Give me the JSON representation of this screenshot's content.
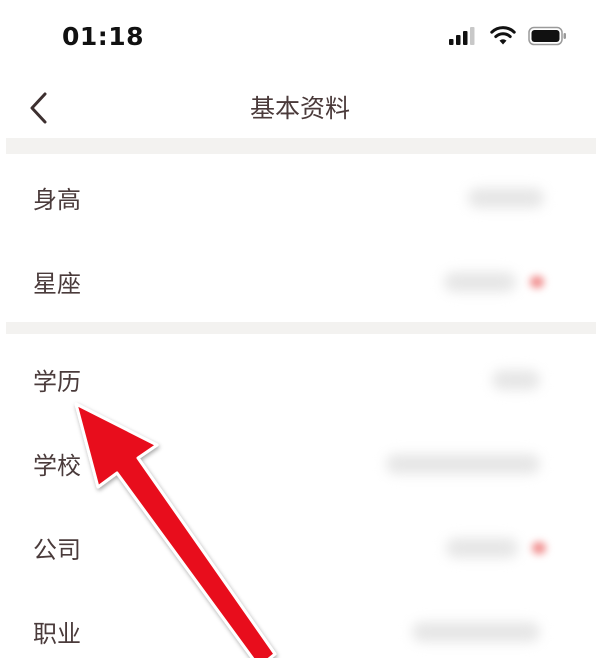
{
  "status_bar": {
    "time": "01:18",
    "icons": [
      "cellular-signal-icon",
      "wifi-icon",
      "battery-icon"
    ]
  },
  "nav": {
    "title": "基本资料",
    "back_icon": "chevron-left-icon"
  },
  "rows": [
    {
      "label": "身高"
    },
    {
      "label": "星座"
    },
    {
      "label": "学历"
    },
    {
      "label": "学校"
    },
    {
      "label": "公司"
    },
    {
      "label": "职业"
    }
  ],
  "annotation": {
    "type": "arrow",
    "color": "#e8101a"
  }
}
